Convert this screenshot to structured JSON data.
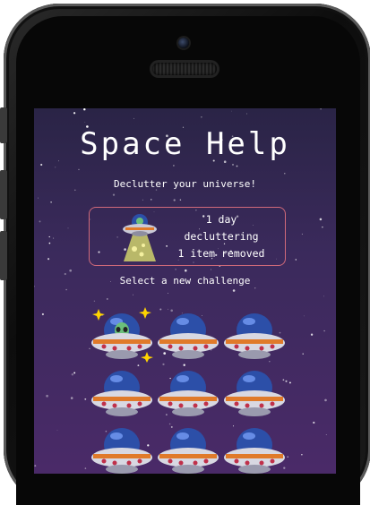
{
  "app": {
    "title": "Space Help",
    "subtitle": "Declutter your universe!"
  },
  "stats": {
    "line1": "1 day",
    "line2": "decluttering",
    "line3": "1 item removed"
  },
  "select_prompt": "Select a new challenge",
  "challenges": [
    {
      "row": 1,
      "col": 1,
      "icon": "alien-ufo-icon",
      "highlighted": true
    },
    {
      "row": 1,
      "col": 2,
      "icon": "ufo-icon",
      "highlighted": false
    },
    {
      "row": 1,
      "col": 3,
      "icon": "ufo-icon",
      "highlighted": false
    },
    {
      "row": 2,
      "col": 1,
      "icon": "ufo-icon",
      "highlighted": false
    },
    {
      "row": 2,
      "col": 2,
      "icon": "ufo-icon",
      "highlighted": false
    },
    {
      "row": 2,
      "col": 3,
      "icon": "ufo-icon",
      "highlighted": false
    },
    {
      "row": 3,
      "col": 1,
      "icon": "ufo-icon",
      "highlighted": false
    },
    {
      "row": 3,
      "col": 2,
      "icon": "ufo-icon",
      "highlighted": false
    },
    {
      "row": 3,
      "col": 3,
      "icon": "ufo-icon",
      "highlighted": false
    }
  ],
  "colors": {
    "background_top": "#2a2446",
    "background_bottom": "#4a2a68",
    "accent_border": "#d06a7a",
    "ufo_dome": "#2c4fa8",
    "ufo_ring": "#e07a2a"
  }
}
